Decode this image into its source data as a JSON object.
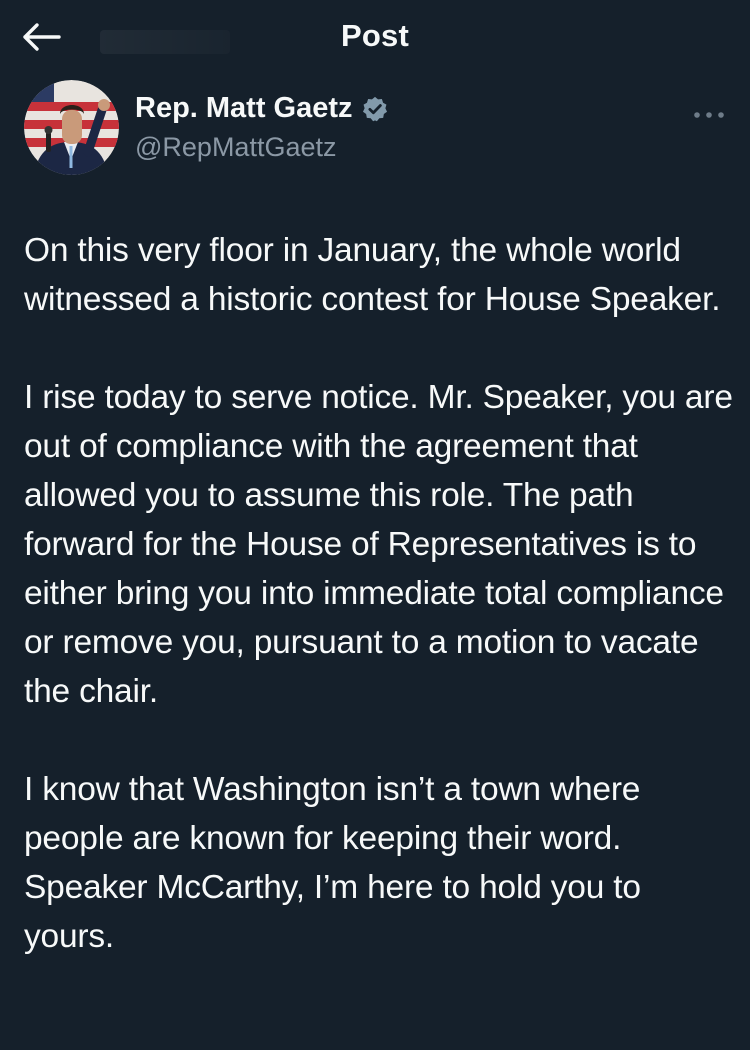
{
  "header": {
    "back_icon": "arrow-left-icon",
    "title": "Post"
  },
  "author": {
    "display_name": "Rep. Matt Gaetz",
    "handle": "@RepMattGaetz",
    "verified_icon": "verified-badge-icon",
    "verified_color": "#829aab",
    "more_icon": "more-horizontal-icon"
  },
  "post": {
    "paragraphs": [
      "On this very floor in January, the whole world witnessed a historic contest for House Speaker.",
      "I rise today to serve notice. Mr. Speaker, you are out of compliance with the agreement that allowed you to assume this role. The path forward for the House of Representatives is to either bring you into immediate total compliance or remove you, pursuant to a motion to vacate the chair.",
      "I know that Washington isn’t a town where people are known for keeping their word. Speaker McCarthy, I’m here to hold you to yours."
    ]
  },
  "colors": {
    "background": "#15202b",
    "text": "#f7f9f9",
    "secondary_text": "#8b98a5"
  }
}
